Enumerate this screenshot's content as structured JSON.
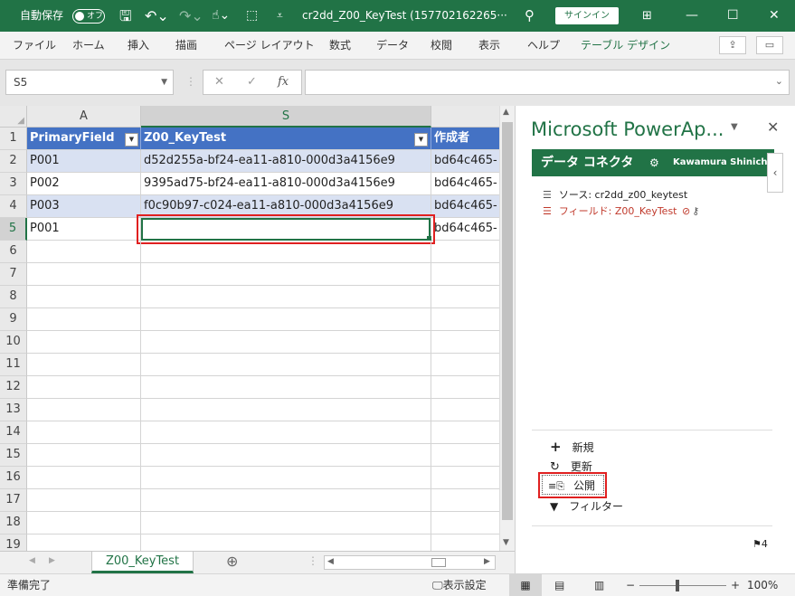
{
  "titlebar": {
    "autosave_label": "自動保存",
    "autosave_state": "オフ",
    "save_icon": "save-icon",
    "filename": "cr2dd_Z00_KeyTest (157702162265···",
    "signin": "サインイン"
  },
  "ribbon": {
    "tabs": [
      "ファイル",
      "ホーム",
      "挿入",
      "描画",
      "ページ レイアウト",
      "数式",
      "データ",
      "校閲",
      "表示",
      "ヘルプ",
      "テーブル デザイン"
    ]
  },
  "formula_bar": {
    "name_box": "S5",
    "fx": "fx",
    "cancel": "✕",
    "confirm": "✓",
    "value": ""
  },
  "grid": {
    "columns": [
      "A",
      "S"
    ],
    "headers": [
      "PrimaryField",
      "Z00_KeyTest",
      "作成者"
    ],
    "rows": [
      {
        "num": "1"
      },
      {
        "num": "2",
        "a": "P001",
        "s": "d52d255a-bf24-ea11-a810-000d3a4156e9",
        "c": "bd64c465-"
      },
      {
        "num": "3",
        "a": "P002",
        "s": "9395ad75-bf24-ea11-a810-000d3a4156e9",
        "c": "bd64c465-"
      },
      {
        "num": "4",
        "a": "P003",
        "s": "f0c90b97-c024-ea11-a810-000d3a4156e9",
        "c": "bd64c465-"
      },
      {
        "num": "5",
        "a": "P001",
        "s": "",
        "c": "bd64c465-"
      }
    ],
    "empty_rows": [
      "6",
      "7",
      "8",
      "9",
      "10",
      "11",
      "12",
      "13",
      "14",
      "15",
      "16",
      "17",
      "18",
      "19"
    ]
  },
  "sheet_tab": "Z00_KeyTest",
  "pane": {
    "title": "Microsoft PowerAp...",
    "header_label": "データ コネクタ",
    "user": "Kawamura Shinichi",
    "source": "ソース: cr2dd_z00_keytest",
    "field": "フィールド: Z00_KeyTest",
    "actions": {
      "new": "新規",
      "refresh": "更新",
      "publish": "公開",
      "filter": "フィルター"
    },
    "flag_count": "4",
    "colors": {
      "accent": "#217346",
      "field": "#c0392b",
      "highlight": "#e02020"
    }
  },
  "status": {
    "ready": "準備完了",
    "display_settings": "表示設定",
    "zoom": "100%"
  }
}
